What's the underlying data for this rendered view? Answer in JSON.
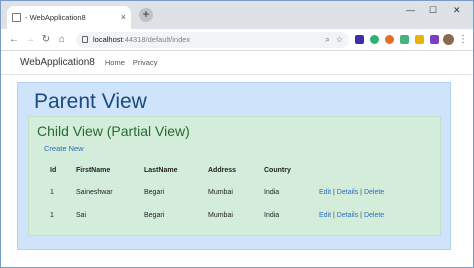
{
  "browser": {
    "tab_title": "- WebApplication8",
    "tab_close": "×",
    "new_tab": "+",
    "url_host": "localhost",
    "url_path": ":44318/default/index",
    "win_min": "—",
    "win_max": "☐",
    "win_close": "✕"
  },
  "navbar": {
    "brand": "WebApplication8",
    "links": [
      "Home",
      "Privacy"
    ]
  },
  "parent": {
    "title": "Parent View"
  },
  "child": {
    "title": "Child View (Partial View)",
    "create_link": "Create New"
  },
  "table": {
    "headers": [
      "Id",
      "FirstName",
      "LastName",
      "Address",
      "Country"
    ],
    "rows": [
      {
        "id": "1",
        "first": "Saineshwar",
        "last": "Begari",
        "address": "Mumbai",
        "country": "India"
      },
      {
        "id": "1",
        "first": "Sai",
        "last": "Begari",
        "address": "Mumbai",
        "country": "India"
      }
    ],
    "actions": {
      "edit": "Edit",
      "details": "Details",
      "delete": "Delete",
      "sep": "|"
    }
  },
  "colors": {
    "parent_bg": "#cfe4fa",
    "child_bg": "#d4edda",
    "parent_title": "#1b4a7e",
    "child_title": "#246b2f",
    "link": "#2a6ebb"
  },
  "icons": [
    "back-arrow-icon",
    "forward-arrow-icon",
    "reload-icon",
    "home-icon",
    "lock-icon",
    "zoom-icon",
    "star-icon",
    "extension-icons",
    "profile-avatar",
    "menu-icon"
  ]
}
